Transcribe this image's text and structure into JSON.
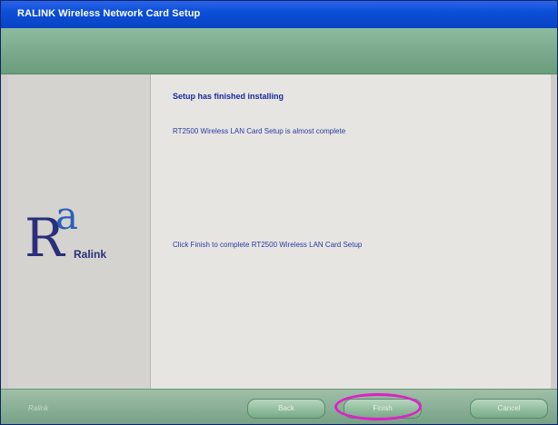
{
  "window": {
    "title": "RALINK Wireless Network Card Setup"
  },
  "content": {
    "heading": "Setup has finished installing",
    "message_almost": "RT2500 Wireless LAN Card Setup is almost complete",
    "message_finish": "Click Finish to complete RT2500 Wireless LAN Card Setup"
  },
  "sidebar": {
    "logo_text": "Ralink"
  },
  "buttons": {
    "back_label": "Back",
    "finish_label": "Finish",
    "cancel_label": "Cancel"
  },
  "footer": {
    "brand_text": "Ralink"
  },
  "colors": {
    "title_bar": "#0b4fd8",
    "banner": "#79a98a",
    "heading_text": "#1a2a9a",
    "highlight": "#e020c8"
  }
}
